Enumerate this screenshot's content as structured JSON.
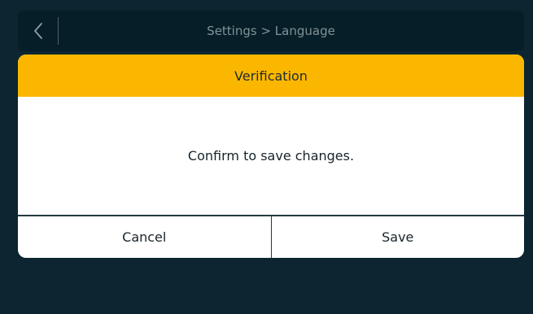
{
  "top_bar": {
    "back_icon": "chevron-left-icon",
    "title": "Settings > Language"
  },
  "dialog": {
    "title": "Verification",
    "message": "Confirm to save changes.",
    "cancel_label": "Cancel",
    "save_label": "Save"
  },
  "colors": {
    "background": "#0d2530",
    "top_bar": "#061e27",
    "accent": "#fbb700",
    "dialog_bg": "#ffffff"
  }
}
